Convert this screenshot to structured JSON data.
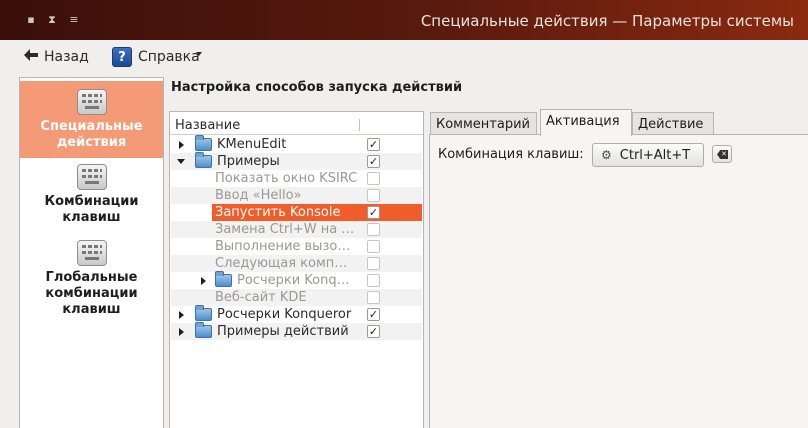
{
  "window": {
    "title": "Специальные действия — Параметры системы",
    "buttons": [
      "close",
      "minimize",
      "menu"
    ]
  },
  "toolbar": {
    "back_label": "Назад",
    "help_label": "Справка",
    "help_icon_glyph": "?"
  },
  "sidebar": {
    "items": [
      {
        "label": "Специальные действия",
        "icon": "keyboard-icon",
        "active": true
      },
      {
        "label": "Комбинации клавиш",
        "icon": "keyboard-icon",
        "active": false
      },
      {
        "label": "Глобальные комбинации клавиш",
        "icon": "keyboard-icon",
        "active": false
      }
    ],
    "active_color": "#f49a76"
  },
  "main": {
    "header": "Настройка способов запуска действий"
  },
  "tree": {
    "column_name": "Название",
    "rows": [
      {
        "label": "KMenuEdit",
        "type": "folder",
        "expander": "collapsed",
        "level": 0,
        "checked": true,
        "enabled": true
      },
      {
        "label": "Примеры",
        "type": "folder",
        "expander": "expanded",
        "level": 0,
        "checked": true,
        "enabled": true
      },
      {
        "label": "Показать окно KSIRC",
        "type": "action",
        "level": 1,
        "checked": false,
        "enabled": false
      },
      {
        "label": "Ввод «Hello»",
        "type": "action",
        "level": 1,
        "checked": false,
        "enabled": false
      },
      {
        "label": "Запустить Konsole",
        "type": "action",
        "level": 1,
        "checked": true,
        "enabled": true,
        "selected": true
      },
      {
        "label": "Замена Ctrl+W на …",
        "type": "action",
        "level": 1,
        "checked": false,
        "enabled": false
      },
      {
        "label": "Выполнение вызо…",
        "type": "action",
        "level": 1,
        "checked": false,
        "enabled": false
      },
      {
        "label": "Следующая комп…",
        "type": "action",
        "level": 1,
        "checked": false,
        "enabled": false
      },
      {
        "label": "Росчерки Konq…",
        "type": "folder",
        "expander": "collapsed",
        "level": 1,
        "checked": false,
        "enabled": false
      },
      {
        "label": "Веб-сайт KDE",
        "type": "action",
        "level": 1,
        "checked": false,
        "enabled": false
      },
      {
        "label": "Росчерки Konqueror",
        "type": "folder",
        "expander": "collapsed",
        "level": 0,
        "checked": true,
        "enabled": true
      },
      {
        "label": "Примеры действий",
        "type": "folder",
        "expander": "collapsed",
        "level": 0,
        "checked": true,
        "enabled": true
      }
    ],
    "selection_color": "#f05d2b"
  },
  "tabs": [
    {
      "label": "Комментарий",
      "active": false
    },
    {
      "label": "Активация",
      "active": true
    },
    {
      "label": "Действие",
      "active": false
    }
  ],
  "activation": {
    "shortcut_label": "Комбинация клавиш:",
    "shortcut_value": "Ctrl+Alt+T"
  }
}
